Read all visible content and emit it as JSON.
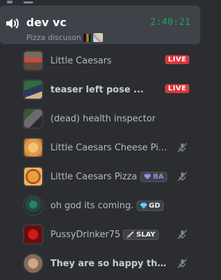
{
  "channel": {
    "name": "dev vc",
    "timer": "2:40:21",
    "status_text": "Pizza discuson"
  },
  "users": [
    {
      "name": "Little Caesars",
      "badge": "LIVE",
      "muted": false
    },
    {
      "name": "teaser left pose ...",
      "badge": "LIVE",
      "muted": false
    },
    {
      "name": "(dead) health inspector",
      "badge": "",
      "muted": false
    },
    {
      "name": "Little Caesars Cheese Pi...",
      "badge": "",
      "muted": true
    },
    {
      "name": "Little Caesars Pizza",
      "tag": "BA",
      "muted": true
    },
    {
      "name": "oh god its coming.",
      "tag": "GD",
      "muted": false
    },
    {
      "name": "PussyDrinker75",
      "tag": "SLAY",
      "muted": true
    },
    {
      "name": "They are so happy tha...",
      "badge": "",
      "muted": true
    }
  ],
  "colors": {
    "background": "#2b2d31",
    "channel_bg": "#404249",
    "timer": "#23a559",
    "live": "#da373c"
  },
  "icons": {
    "channel": "speaker-icon",
    "muted": "microphone-muted-icon",
    "gd_tag": "diamond-icon",
    "ba_tag": "heart-icon",
    "slay_tag": "sword-icon"
  }
}
